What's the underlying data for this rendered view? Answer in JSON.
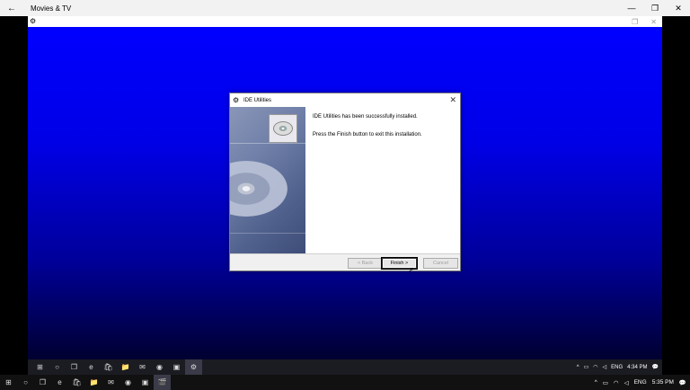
{
  "outer_window": {
    "title": "Movies & TV",
    "back_glyph": "←",
    "minimize_glyph": "—",
    "maximize_glyph": "❐",
    "close_glyph": "✕"
  },
  "vm_window": {
    "app_icon_glyph": "⚙",
    "restore_glyph": "❐",
    "close_glyph": "✕"
  },
  "dialog": {
    "title": "IDE Utilities",
    "icon_glyph": "⚙",
    "close_glyph": "✕",
    "message1": "IDE Utilities has been successfully installed.",
    "message2": "Press the Finish button to exit this installation.",
    "buttons": {
      "back": "< Back",
      "finish": "Finish >",
      "cancel": "Cancel"
    }
  },
  "inner_taskbar": {
    "icons": [
      "windows-icon",
      "cortana-icon",
      "task-view-icon",
      "edge-icon",
      "store-icon",
      "explorer-icon",
      "mail-icon",
      "chrome-icon",
      "app-icon",
      "setup-icon"
    ],
    "glyphs": [
      "⊞",
      "○",
      "❐",
      "e",
      "🛍",
      "📁",
      "✉",
      "◉",
      "▣",
      "⚙"
    ],
    "tray": {
      "chevron": "^",
      "language": "ENG",
      "time": "4:34 PM",
      "notification_glyph": "💬"
    }
  },
  "outer_taskbar": {
    "icons": [
      "windows-icon",
      "cortana-icon",
      "task-view-icon",
      "edge-icon",
      "store-icon",
      "explorer-icon",
      "mail-icon",
      "chrome-icon",
      "app-icon",
      "movies-icon"
    ],
    "glyphs": [
      "⊞",
      "○",
      "❐",
      "e",
      "🛍",
      "📁",
      "✉",
      "◉",
      "▣",
      "🎬"
    ],
    "tray": {
      "chevron": "^",
      "language": "ENG",
      "time": "5:35 PM",
      "notification_glyph": "💬"
    }
  },
  "colors": {
    "desktop_blue": "#0000ff",
    "taskbar_dark": "#1b1b22"
  }
}
